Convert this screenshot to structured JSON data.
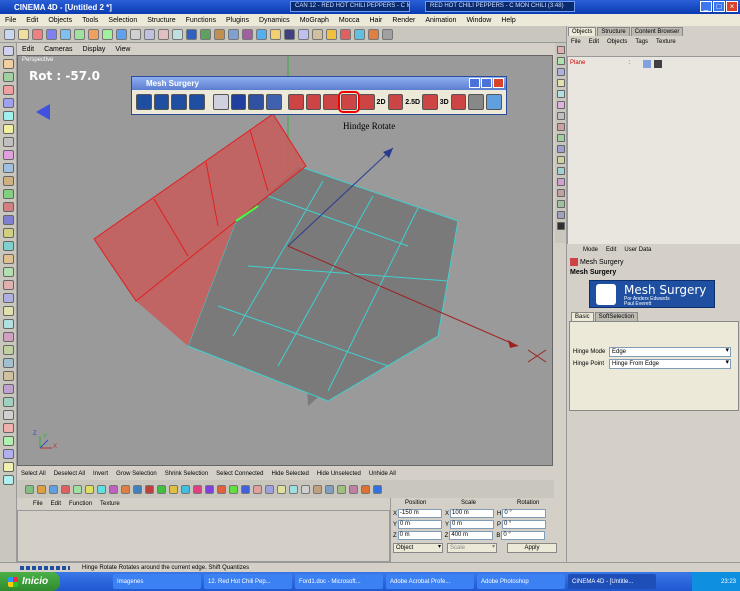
{
  "window": {
    "title": "CINEMA 4D - [Untitled 2 *]",
    "title_strip_1": "CAN 12 - RED HOT CHILI PEPPERS - C MON CHILI (3:48)",
    "title_strip_2": "RED HOT CHILI PEPPERS - C MON CHILI (3:48)"
  },
  "menu": [
    "File",
    "Edit",
    "Objects",
    "Tools",
    "Selection",
    "Structure",
    "Functions",
    "Plugins",
    "Dynamics",
    "MoGraph",
    "Mocca",
    "Hair",
    "Render",
    "Animation",
    "Window",
    "Help"
  ],
  "viewport": {
    "menu": [
      "Edit",
      "Cameras",
      "Display",
      "View"
    ],
    "label": "Perspective",
    "rotation_readout": "Rot : -57.0",
    "annotation": "Hindge Rotate",
    "axis_x": "X",
    "axis_y": "Y",
    "axis_z": "Z"
  },
  "mesh_surgery": {
    "title": "Mesh Surgery",
    "labels": [
      "2D",
      "2.5D",
      "3D"
    ]
  },
  "objects_panel": {
    "tabs": [
      "Objects",
      "Structure",
      "Content Browser"
    ],
    "menu": [
      "File",
      "Edit",
      "Objects",
      "Tags",
      "Texture"
    ],
    "object_name": "Plane"
  },
  "attributes_panel": {
    "menu": [
      "Mode",
      "Edit",
      "User Data"
    ],
    "header": "Mesh Surgery",
    "section": "Mesh Surgery",
    "logo_title": "Mesh Surgery",
    "logo_sub1": "Por Anders Edwards",
    "logo_sub2": "Paul Everett",
    "tabs": [
      "Basic",
      "SoftSelection"
    ],
    "hinge_mode_label": "Hinge Mode",
    "hinge_mode_value": "Edge",
    "hinge_point_label": "Hinge Point",
    "hinge_point_value": "Hinge From Edge"
  },
  "selection_menu": [
    "Select All",
    "Deselect All",
    "Invert",
    "Grow Selection",
    "Shrink Selection",
    "Select Connected",
    "Hide Selected",
    "Hide Unselected",
    "Unhide All"
  ],
  "timeline_menu": [
    "File",
    "Edit",
    "Function",
    "Texture"
  ],
  "coordinates": {
    "headers": [
      "Position",
      "Scale",
      "Rotation"
    ],
    "rows": [
      {
        "axis1": "X",
        "pos": "-150 m",
        "axis2": "X",
        "scale": "100 m",
        "axis3": "H",
        "rot": "0 °"
      },
      {
        "axis1": "Y",
        "pos": "0 m",
        "axis2": "Y",
        "scale": "0 m",
        "axis3": "P",
        "rot": "0 °"
      },
      {
        "axis1": "Z",
        "pos": "0 m",
        "axis2": "Z",
        "scale": "400 m",
        "axis3": "B",
        "rot": "0 °"
      }
    ],
    "object_mode": "Object",
    "scale_mode": "Scale",
    "apply_label": "Apply"
  },
  "status": {
    "text": "Hinge Rotate     Rotates  around the current edge. Shift Quantizes"
  },
  "taskbar": {
    "start_label": "Inicio",
    "items": [
      "Imagenes",
      "12. Red Hot Chili Pep...",
      "Ford1.doc - Microsoft...",
      "Adobe Acrobat Profe...",
      "Adobe Photoshop",
      "CINEMA 4D - [Untitle..."
    ],
    "clock": "23:23"
  },
  "colors": {
    "xp_blue": "#1f57d0",
    "viewport_bg": "#9a9a9a",
    "hinge_red": "#c85a5a",
    "mesh_edge": "#40d0d0"
  }
}
